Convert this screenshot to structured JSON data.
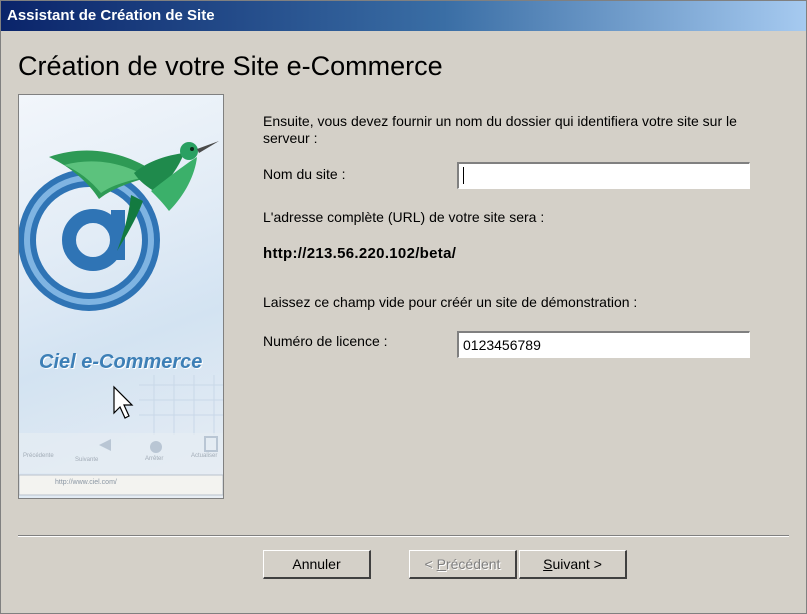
{
  "window": {
    "title": "Assistant de Création de Site"
  },
  "page": {
    "heading": "Création de votre Site e-Commerce"
  },
  "side_panel": {
    "brand_text": "Ciel e-Commerce",
    "url_bar_text": "http://www.ciel.com/",
    "toolbar_labels": [
      "Précédente",
      "Suivante",
      "Arrêter",
      "Actualiser"
    ]
  },
  "form": {
    "intro_text": "Ensuite, vous devez fournir un nom du dossier qui identifiera votre site sur le serveur :",
    "site_name_label": "Nom du site :",
    "site_name_value": "",
    "url_label": "L'adresse complète (URL) de votre site sera :",
    "url_value": "http://213.56.220.102/beta/",
    "demo_hint": "Laissez ce champ vide pour créér un site de démonstration :",
    "licence_label": "Numéro de licence :",
    "licence_value": "0123456789"
  },
  "buttons": {
    "cancel": "Annuler",
    "previous_mnemonic": "P",
    "previous_prefix": "< ",
    "previous_rest": "récédent",
    "next_mnemonic": "S",
    "next_rest": "uivant >"
  },
  "colors": {
    "titlebar_start": "#0a246a",
    "titlebar_end": "#a6caf0",
    "dialog_bg": "#d4d0c8",
    "brand": "#3d7fb6"
  }
}
